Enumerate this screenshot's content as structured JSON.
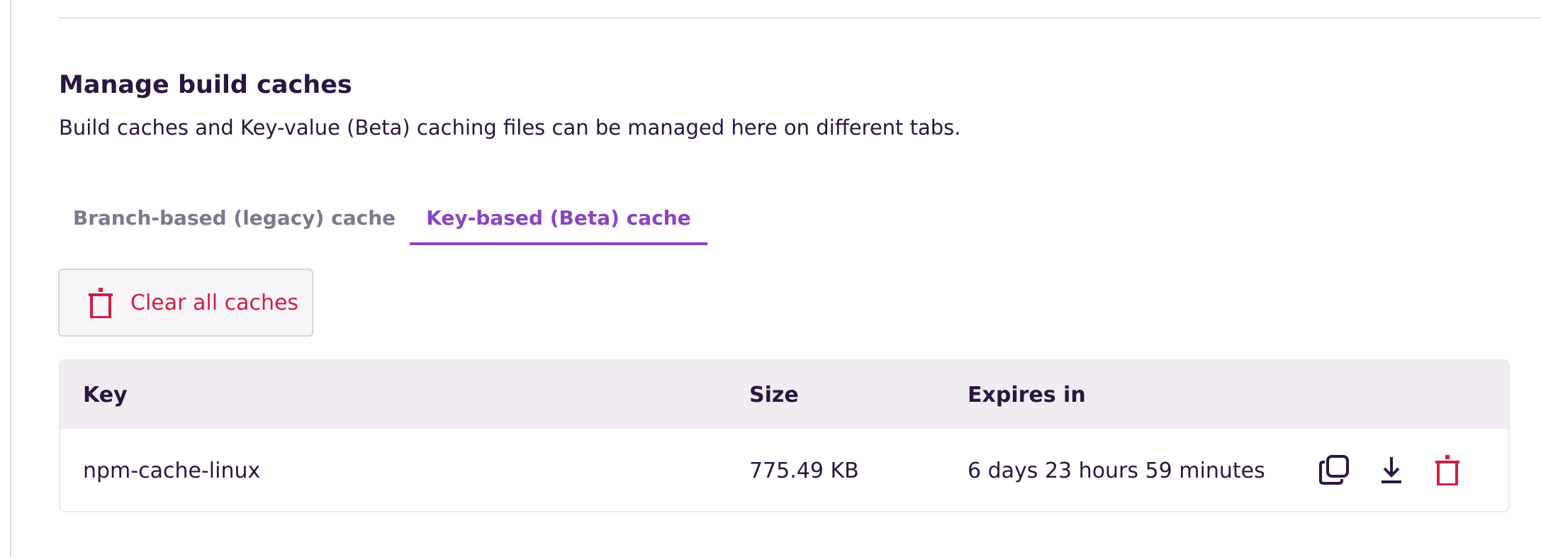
{
  "page": {
    "title": "Manage build caches",
    "description": "Build caches and Key-value (Beta) caching files can be managed here on different tabs."
  },
  "tabs": [
    {
      "label": "Branch-based (legacy) cache",
      "active": false
    },
    {
      "label": "Key-based (Beta) cache",
      "active": true
    }
  ],
  "clear_button": {
    "label": "Clear all caches",
    "icon": "trash-icon"
  },
  "table": {
    "columns": [
      "Key",
      "Size",
      "Expires in"
    ],
    "rows": [
      {
        "key": "npm-cache-linux",
        "size": "775.49 KB",
        "expires": "6 days 23 hours 59 minutes",
        "actions": [
          "copy-icon",
          "download-icon",
          "trash-icon"
        ]
      }
    ]
  },
  "colors": {
    "accent": "#8a43c4",
    "danger": "#cf1f42",
    "text": "#2b1640",
    "muted": "#80798a",
    "header_bg": "#f0ecf1"
  }
}
